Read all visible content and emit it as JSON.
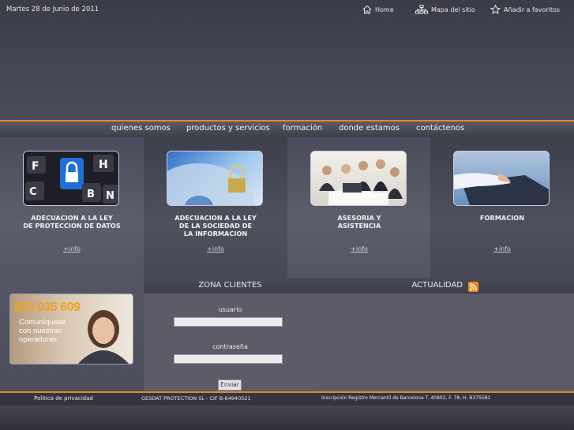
{
  "header": {
    "date": "Martes 28 de Junio de 2011",
    "links": [
      {
        "label": "Home",
        "icon": "home-icon"
      },
      {
        "label": "Mapa del sitio",
        "icon": "sitemap-icon"
      },
      {
        "label": "Añadir a favoritos",
        "icon": "star-icon"
      }
    ]
  },
  "nav": {
    "items": [
      "quienes somos",
      "productos y servicios",
      "formación",
      "donde estamos",
      "contáctenos"
    ]
  },
  "services": [
    {
      "title_line1": "ADECUACION A LA LEY",
      "title_line2": "DE PROTECCION DE DATOS",
      "title_line3": "",
      "more": "+info"
    },
    {
      "title_line1": "ADECUACION A LA LEY",
      "title_line2": "DE LA SOCIEDAD DE",
      "title_line3": "LA INFORMACION",
      "more": "+info"
    },
    {
      "title_line1": "ASESORIA Y",
      "title_line2": "ASISTENCIA",
      "title_line3": "",
      "more": "+info"
    },
    {
      "title_line1": "FORMACION",
      "title_line2": "",
      "title_line3": "",
      "more": "+info"
    }
  ],
  "phone_banner": {
    "number": "933 035 609",
    "line1": "Comuníquese",
    "line2": "con nuestras",
    "line3": "operadoras"
  },
  "zona_clientes": {
    "heading": "ZONA CLIENTES",
    "user_label": "usuario",
    "password_label": "contraseña",
    "user_value": "",
    "password_value": "",
    "submit_label": "Enviar"
  },
  "actualidad": {
    "heading": "ACTUALIDAD",
    "icon": "rss-icon"
  },
  "footer": {
    "privacy": "Politica de privacidad",
    "company": "GESDAT PROTECTION SL   -   CIF B-64940521",
    "registry": "Inscripción Registro Mercantil de Barcelona T. 40802, F. 78, H. B375581"
  },
  "colors": {
    "accent": "#e08a2c",
    "phone_number": "#f3a21e",
    "rss": "#f28a1c"
  }
}
